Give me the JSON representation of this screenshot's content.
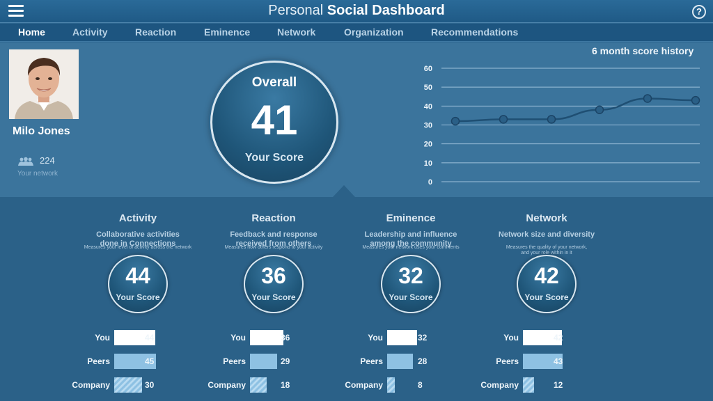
{
  "app": {
    "title_light": "Personal",
    "title_bold": "Social Dashboard",
    "help": "?"
  },
  "nav": {
    "tabs": [
      "Home",
      "Activity",
      "Reaction",
      "Eminence",
      "Network",
      "Organization",
      "Recommendations"
    ],
    "active": "Home"
  },
  "profile": {
    "name": "Milo Jones",
    "network_count": "224",
    "network_label": "Your network"
  },
  "overall": {
    "title": "Overall",
    "score": "41",
    "label": "Your Score"
  },
  "history": {
    "title": "6 month score history"
  },
  "chart_data": {
    "type": "line",
    "title": "6 month score history",
    "x": [
      1,
      2,
      3,
      4,
      5,
      6
    ],
    "y_ticks": [
      0,
      10,
      20,
      30,
      40,
      50,
      60
    ],
    "ylim": [
      0,
      60
    ],
    "grid": true,
    "series": [
      {
        "values": [
          32,
          33,
          33,
          38,
          44,
          43
        ]
      }
    ]
  },
  "categories": [
    {
      "title": "Activity",
      "desc_1": "Collaborative activities",
      "desc_2": "done in Connections",
      "note_1": "Measures your level of activity across the network",
      "note_2": "",
      "score": "44",
      "score_label": "Your Score",
      "you": 44,
      "peers": 45,
      "company": 30
    },
    {
      "title": "Reaction",
      "desc_1": "Feedback and response",
      "desc_2": "received from others",
      "note_1": "Measures how others respond to your activity",
      "note_2": "",
      "score": "36",
      "score_label": "Your Score",
      "you": 36,
      "peers": 29,
      "company": 18
    },
    {
      "title": "Eminence",
      "desc_1": "Leadership and influence",
      "desc_2": "among the community",
      "note_1": "Measures your network uses your comments",
      "note_2": "",
      "score": "32",
      "score_label": "Your Score",
      "you": 32,
      "peers": 28,
      "company": 8
    },
    {
      "title": "Network",
      "desc_1": "Network size and diversity",
      "desc_2": "",
      "note_1": "Measures the quality of your network,",
      "note_2": "and your role within in it",
      "score": "42",
      "score_label": "Your Score",
      "you": 42,
      "peers": 43,
      "company": 12
    }
  ],
  "row_labels": {
    "you": "You",
    "peers": "Peers",
    "company": "Company"
  },
  "colors": {
    "background": "#2e6790",
    "panel_upper": "#3b749c",
    "panel_lower": "#2b6188",
    "bar_you": "#ffffff",
    "bar_peers": "#8ec1e3",
    "line": "#1f4f73"
  }
}
